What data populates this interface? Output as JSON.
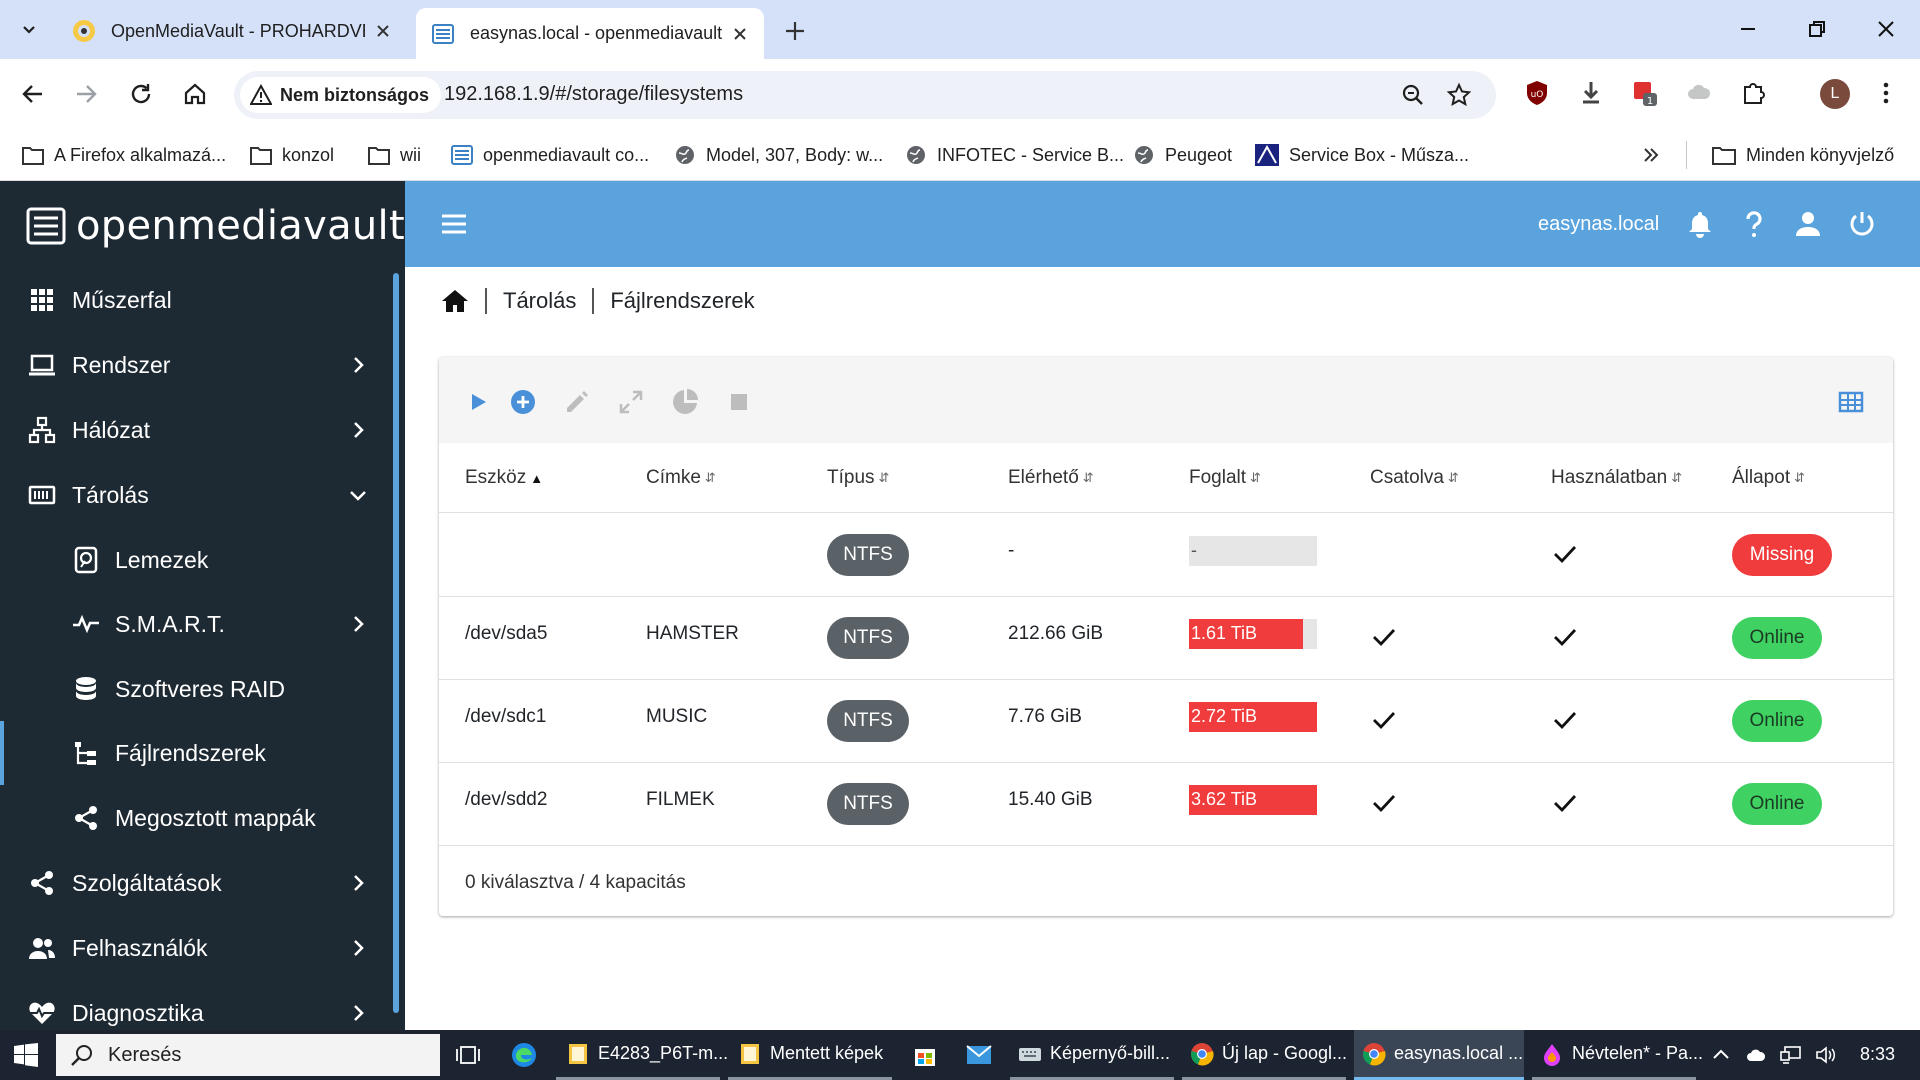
{
  "browser": {
    "tabs": [
      {
        "title": "OpenMediaVault - PROHARDVER",
        "active": false
      },
      {
        "title": "easynas.local - openmediavault",
        "active": true
      }
    ],
    "security_label": "Nem biztonságos",
    "url": "192.168.1.9/#/storage/filesystems",
    "profile_initial": "L",
    "extension_badge": "1",
    "bookmarks": [
      "A Firefox alkalmazá...",
      "konzol",
      "wii",
      "openmediavault co...",
      "Model, 307, Body: w...",
      "INFOTEC - Service B...",
      "Peugeot",
      "Service Box - Műsza..."
    ],
    "all_bookmarks": "Minden könyvjelző"
  },
  "app": {
    "brand": "openmediavault",
    "hostname": "easynas.local",
    "colors": {
      "sidebar_bg": "#1e2a33",
      "topbar_bg": "#5aa3dd",
      "missing": "#f03c3c",
      "online": "#3fd262"
    },
    "menu": [
      {
        "label": "Műszerfal",
        "icon": "dashboard-icon"
      },
      {
        "label": "Rendszer",
        "icon": "laptop-icon"
      },
      {
        "label": "Hálózat",
        "icon": "network-icon"
      },
      {
        "label": "Tárolás",
        "icon": "storage-icon"
      },
      {
        "label": "Lemezek",
        "icon": "disk-icon"
      },
      {
        "label": "S.M.A.R.T.",
        "icon": "pulse-icon"
      },
      {
        "label": "Szoftveres RAID",
        "icon": "database-icon"
      },
      {
        "label": "Fájlrendszerek",
        "icon": "tree-icon"
      },
      {
        "label": "Megosztott mappák",
        "icon": "share-icon"
      },
      {
        "label": "Szolgáltatások",
        "icon": "share-icon"
      },
      {
        "label": "Felhasználók",
        "icon": "users-icon"
      },
      {
        "label": "Diagnosztika",
        "icon": "heart-pulse-icon"
      }
    ],
    "breadcrumb": [
      "Tárolás",
      "Fájlrendszerek"
    ],
    "table": {
      "columns": [
        "Eszköz",
        "Címke",
        "Típus",
        "Elérhető",
        "Foglalt",
        "Csatolva",
        "Használatban",
        "Állapot"
      ],
      "rows": [
        {
          "device": "",
          "label": "",
          "type": "NTFS",
          "available": "-",
          "used": "-",
          "used_fraction": 0,
          "mounted": false,
          "referenced": true,
          "status": "Missing"
        },
        {
          "device": "/dev/sda5",
          "label": "HAMSTER",
          "type": "NTFS",
          "available": "212.66 GiB",
          "used": "1.61 TiB",
          "used_fraction": 0.89,
          "mounted": true,
          "referenced": true,
          "status": "Online"
        },
        {
          "device": "/dev/sdc1",
          "label": "MUSIC",
          "type": "NTFS",
          "available": "7.76 GiB",
          "used": "2.72 TiB",
          "used_fraction": 1.0,
          "mounted": true,
          "referenced": true,
          "status": "Online"
        },
        {
          "device": "/dev/sdd2",
          "label": "FILMEK",
          "type": "NTFS",
          "available": "15.40 GiB",
          "used": "3.62 TiB",
          "used_fraction": 1.0,
          "mounted": true,
          "referenced": true,
          "status": "Online"
        }
      ],
      "footer": "0 kiválasztva / 4 kapacitás"
    }
  },
  "taskbar": {
    "search": "Keresés",
    "apps": [
      "E4283_P6T-m...",
      "Mentett képek",
      "Képernyő-bill...",
      "Új lap - Googl...",
      "easynas.local ...",
      "Névtelen* - Pa..."
    ],
    "time": "8:33"
  }
}
